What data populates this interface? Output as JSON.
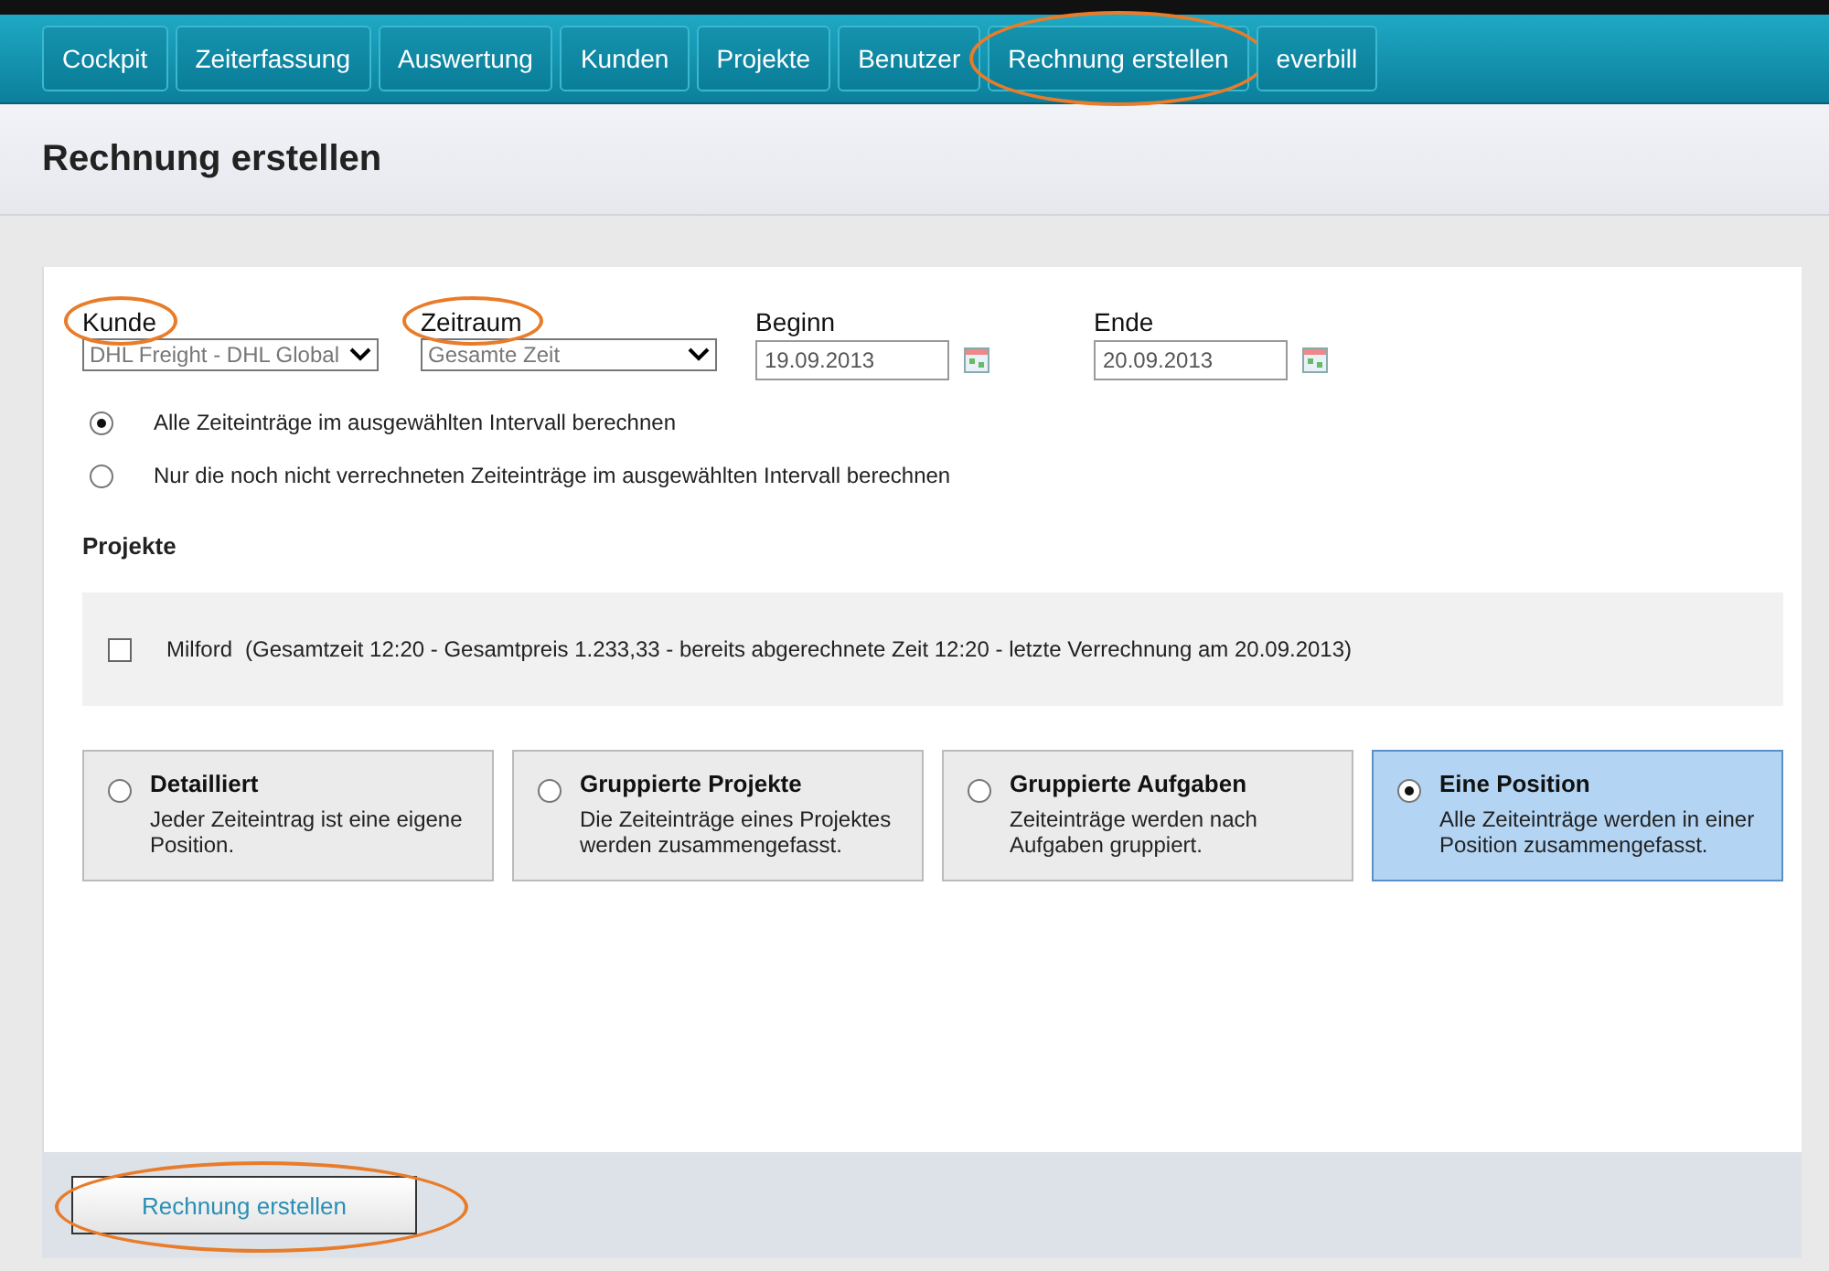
{
  "nav": [
    {
      "label": "Cockpit",
      "highlighted": false
    },
    {
      "label": "Zeiterfassung",
      "highlighted": false
    },
    {
      "label": "Auswertung",
      "highlighted": false
    },
    {
      "label": "Kunden",
      "highlighted": false
    },
    {
      "label": "Projekte",
      "highlighted": false
    },
    {
      "label": "Benutzer",
      "highlighted": false
    },
    {
      "label": "Rechnung erstellen",
      "highlighted": true
    },
    {
      "label": "everbill",
      "highlighted": false
    }
  ],
  "page_title": "Rechnung erstellen",
  "fields": [
    {
      "kind": "select",
      "label": "Kunde",
      "value": "DHL Freight - DHL Global",
      "highlighted": true
    },
    {
      "kind": "select",
      "label": "Zeitraum",
      "value": "Gesamte Zeit",
      "highlighted": true
    },
    {
      "kind": "date",
      "label": "Beginn",
      "value": "19.09.2013",
      "highlighted": false
    },
    {
      "kind": "date",
      "label": "Ende",
      "value": "20.09.2013",
      "highlighted": false
    }
  ],
  "interval_options": [
    {
      "label": "Alle Zeiteinträge im ausgewählten Intervall berechnen",
      "selected": true
    },
    {
      "label": "Nur die noch nicht verrechneten Zeiteinträge im ausgewählten Intervall berechnen",
      "selected": false
    }
  ],
  "projects_heading": "Projekte",
  "projects": [
    {
      "name": "Milford",
      "details": "(Gesamtzeit 12:20 - Gesamtpreis 1.233,33 - bereits abgerechnete Zeit 12:20 - letzte Verrechnung am 20.09.2013)",
      "checked": false
    }
  ],
  "modes": [
    {
      "title": "Detailliert",
      "description": "Jeder Zeiteintrag ist eine eigene Position.",
      "selected": false
    },
    {
      "title": "Gruppierte Projekte",
      "description": "Die Zeiteinträge eines Projektes werden zusammengefasst.",
      "selected": false
    },
    {
      "title": "Gruppierte Aufgaben",
      "description": "Zeiteinträge werden nach Aufgaben gruppiert.",
      "selected": false
    },
    {
      "title": "Eine Position",
      "description": "Alle Zeiteinträge werden in einer Position zusammengefasst.",
      "selected": true
    }
  ],
  "submit": {
    "label": "Rechnung erstellen",
    "highlighted": true
  }
}
